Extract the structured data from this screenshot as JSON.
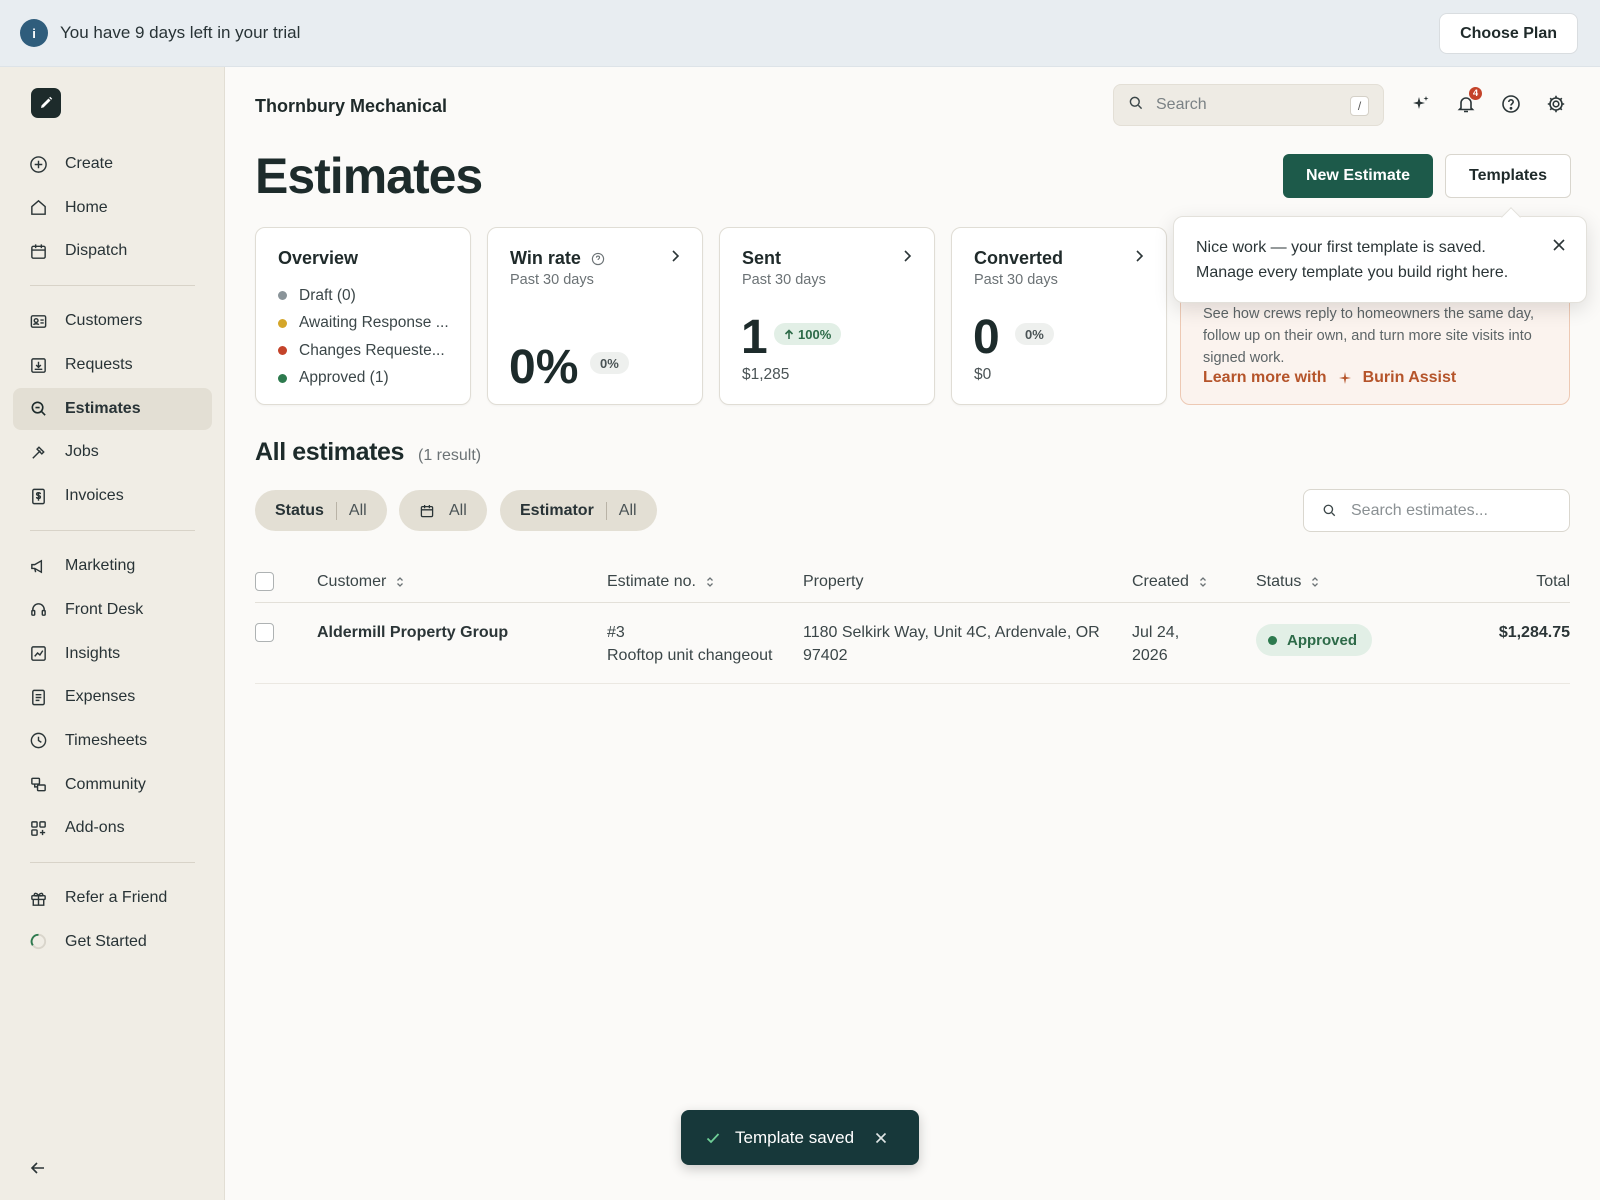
{
  "banner": {
    "message": "You have 9 days left in your trial",
    "cta": "Choose Plan",
    "icon": "info-icon"
  },
  "sidebar": {
    "groups": [
      [
        {
          "label": "Create",
          "icon": "plus-circle-icon"
        },
        {
          "label": "Home",
          "icon": "home-icon"
        },
        {
          "label": "Dispatch",
          "icon": "calendar-icon"
        }
      ],
      [
        {
          "label": "Customers",
          "icon": "contact-card-icon"
        },
        {
          "label": "Requests",
          "icon": "inbox-icon"
        },
        {
          "label": "Estimates",
          "icon": "search-doc-icon",
          "active": true
        },
        {
          "label": "Jobs",
          "icon": "hammer-icon"
        },
        {
          "label": "Invoices",
          "icon": "dollar-doc-icon"
        }
      ],
      [
        {
          "label": "Marketing",
          "icon": "megaphone-icon"
        },
        {
          "label": "Front Desk",
          "icon": "headset-icon"
        },
        {
          "label": "Insights",
          "icon": "chart-icon"
        },
        {
          "label": "Expenses",
          "icon": "receipt-icon"
        },
        {
          "label": "Timesheets",
          "icon": "clock-icon"
        },
        {
          "label": "Community",
          "icon": "community-icon"
        },
        {
          "label": "Add-ons",
          "icon": "add-ons-icon"
        }
      ],
      [
        {
          "label": "Refer a Friend",
          "icon": "gift-icon"
        },
        {
          "label": "Get Started",
          "icon": "progress-ring-icon"
        }
      ]
    ]
  },
  "header": {
    "company": "Thornbury Mechanical",
    "search_placeholder": "Search",
    "search_shortcut": "/",
    "notification_count": "4"
  },
  "page": {
    "title": "Estimates",
    "new_button": "New Estimate",
    "templates_button": "Templates"
  },
  "cards": {
    "overview": {
      "title": "Overview",
      "items": [
        {
          "label": "Draft (0)",
          "color": "#8a9499"
        },
        {
          "label": "Awaiting Response ...",
          "color": "#d4a62a"
        },
        {
          "label": "Changes Requeste...",
          "color": "#c4432a"
        },
        {
          "label": "Approved (1)",
          "color": "#2d7a4e"
        }
      ]
    },
    "win_rate": {
      "title": "Win rate",
      "subtitle": "Past 30 days",
      "value": "0%",
      "pill": "0%"
    },
    "sent": {
      "title": "Sent",
      "subtitle": "Past 30 days",
      "value": "1",
      "pill": "100%",
      "amount": "$1,285"
    },
    "converted": {
      "title": "Converted",
      "subtitle": "Past 30 days",
      "value": "0",
      "pill": "0%",
      "amount": "$0"
    }
  },
  "promo": {
    "text": "See how crews reply to homeowners the same day, follow up on their own, and turn more site visits into signed work.",
    "link_prefix": "Learn more with",
    "link_brand": "Burin Assist"
  },
  "popover": {
    "line1": "Nice work — your first template is saved.",
    "line2": "Manage every template you build right here."
  },
  "estimates": {
    "title": "All estimates",
    "count": "(1 result)",
    "filters": [
      {
        "label": "Status",
        "value": "All"
      },
      {
        "label": "",
        "value": "All",
        "icon": "calendar-icon"
      },
      {
        "label": "Estimator",
        "value": "All"
      }
    ],
    "search_placeholder": "Search estimates...",
    "columns": {
      "customer": "Customer",
      "number": "Estimate no.",
      "property": "Property",
      "created": "Created",
      "status": "Status",
      "total": "Total"
    },
    "rows": [
      {
        "customer": "Aldermill Property Group",
        "number": "#3",
        "description": "Rooftop unit changeout",
        "property_line1": "1180 Selkirk Way, Unit 4C, Ardenvale, OR",
        "property_line2": "97402",
        "created_line1": "Jul 24,",
        "created_line2": "2026",
        "status": "Approved",
        "total": "$1,284.75"
      }
    ]
  },
  "toast": {
    "message": "Template saved"
  }
}
